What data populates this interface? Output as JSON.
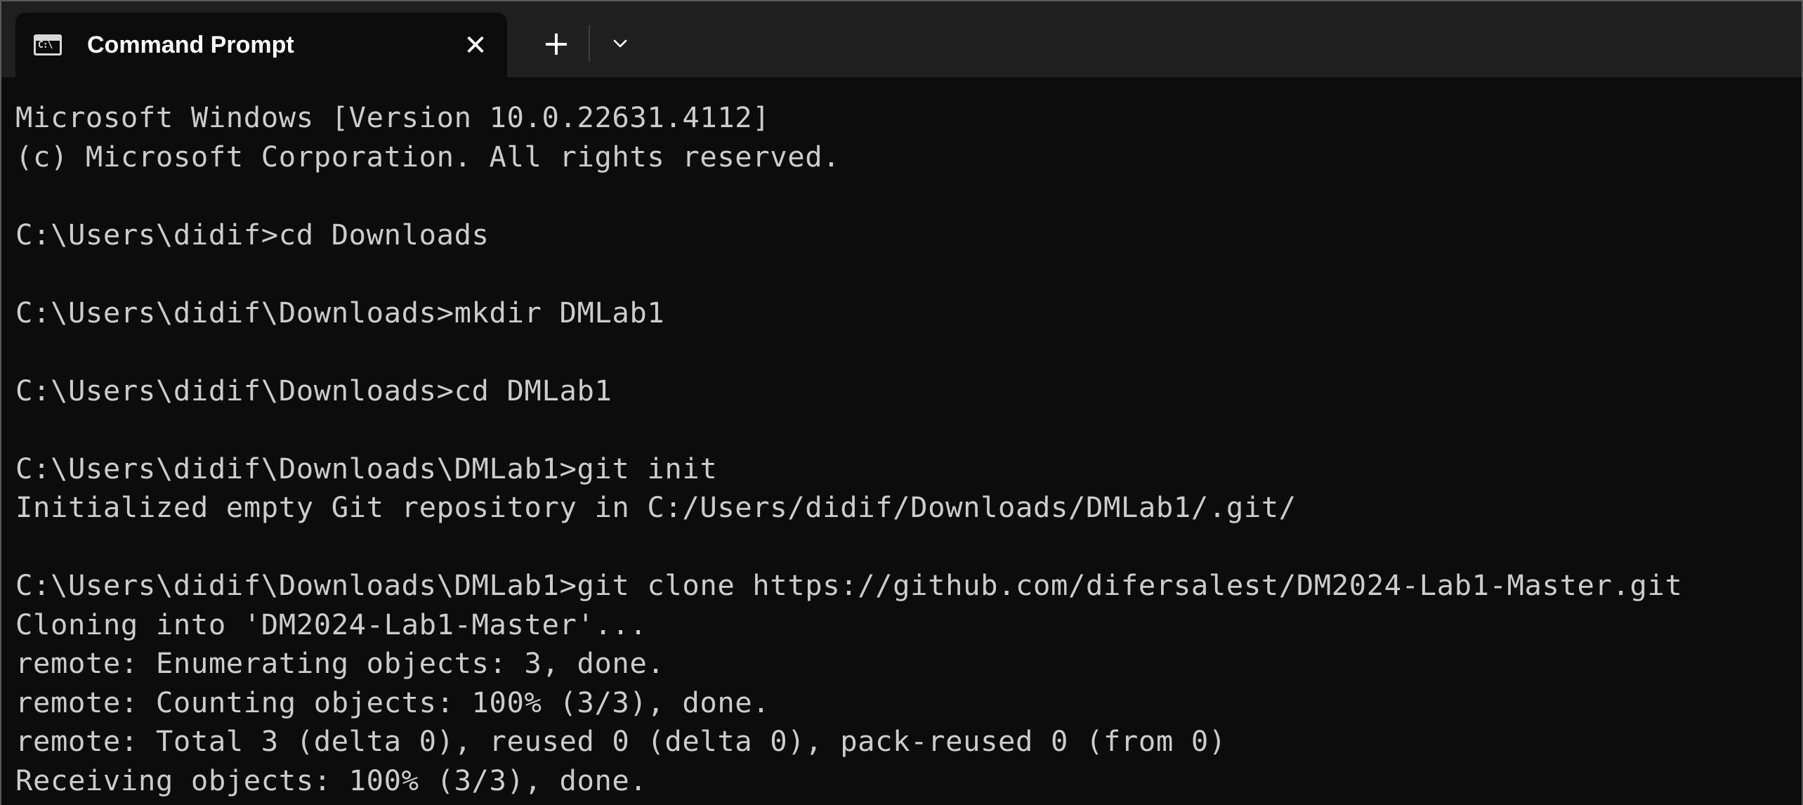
{
  "window": {
    "tab_title": "Command Prompt",
    "tab_icon": "cmd-icon",
    "tab_icon_glyph": "C:\\",
    "close_glyph": "✕",
    "new_tab_glyph": "+",
    "dropdown_icon": "chevron-down-icon"
  },
  "terminal": {
    "lines": [
      "Microsoft Windows [Version 10.0.22631.4112]",
      "(c) Microsoft Corporation. All rights reserved.",
      "",
      "C:\\Users\\didif>cd Downloads",
      "",
      "C:\\Users\\didif\\Downloads>mkdir DMLab1",
      "",
      "C:\\Users\\didif\\Downloads>cd DMLab1",
      "",
      "C:\\Users\\didif\\Downloads\\DMLab1>git init",
      "Initialized empty Git repository in C:/Users/didif/Downloads/DMLab1/.git/",
      "",
      "C:\\Users\\didif\\Downloads\\DMLab1>git clone https://github.com/difersalest/DM2024-Lab1-Master.git",
      "Cloning into 'DM2024-Lab1-Master'...",
      "remote: Enumerating objects: 3, done.",
      "remote: Counting objects: 100% (3/3), done.",
      "remote: Total 3 (delta 0), reused 0 (delta 0), pack-reused 0 (from 0)",
      "Receiving objects: 100% (3/3), done."
    ]
  },
  "colors": {
    "terminal_bg": "#0c0c0c",
    "terminal_text": "#cccccc",
    "titlebar_bg": "#202020",
    "tab_text": "#ffffff"
  }
}
